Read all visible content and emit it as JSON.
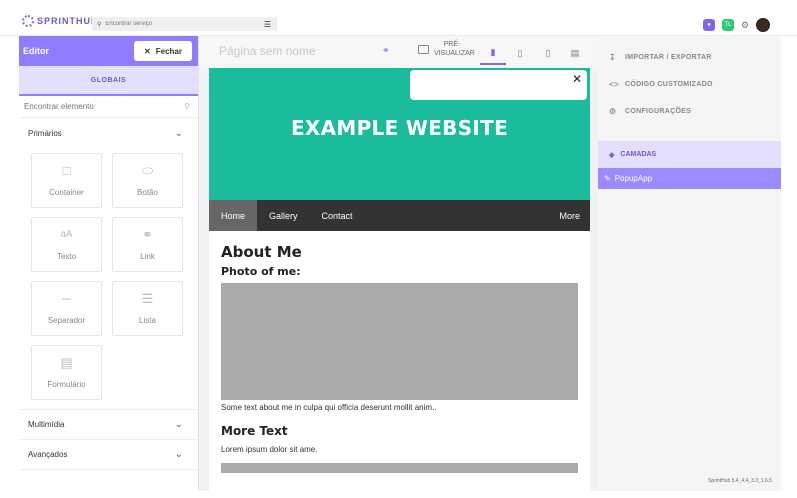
{
  "topbar": {
    "logo_text": "SPRINTHUB",
    "search_placeholder": "Encontrar serviço",
    "badge_green": "TL"
  },
  "left_panel": {
    "title": "Editor",
    "close_label": "Fechar",
    "tab_label": "GLOBAIS",
    "find_placeholder": "Encontrar elemento",
    "sections": {
      "primarios": "Primários",
      "multimidia": "Multimídia",
      "avancados": "Avançados"
    },
    "tiles": [
      {
        "label": "Container",
        "icon": "square-icon"
      },
      {
        "label": "Botão",
        "icon": "pill-icon"
      },
      {
        "label": "Texto",
        "icon": "text-icon"
      },
      {
        "label": "Link",
        "icon": "link-icon"
      },
      {
        "label": "Separador",
        "icon": "separator-icon"
      },
      {
        "label": "Lista",
        "icon": "list-icon"
      },
      {
        "label": "Formulário",
        "icon": "form-icon"
      }
    ]
  },
  "canvas": {
    "page_name_placeholder": "Página sem nome",
    "preview_label": "PRÉ-VISUALIZAR",
    "site": {
      "hero_title": "EXAMPLE WEBSITE",
      "nav": [
        "Home",
        "Gallery",
        "Contact"
      ],
      "nav_more": "More",
      "about_title": "About Me",
      "photo_label": "Photo of me:",
      "about_text": "Some text about me in culpa qui officia deserunt mollit anim..",
      "more_title": "More Text",
      "more_text": "Lorem ipsum dolor sit ame."
    }
  },
  "right_panel": {
    "items": [
      "IMPORTAR / EXPORTAR",
      "CÓDIGO CUSTOMIZADO",
      "CONFIGURAÇÕES"
    ],
    "layers_label": "CAMADAS",
    "layer_item": "PopupApp"
  },
  "version": "SprintHub 5.4_4.4_3.3_1.6.5",
  "colors": {
    "accent": "#8e7dff",
    "hero": "#1abc9c",
    "nav": "#333333"
  }
}
